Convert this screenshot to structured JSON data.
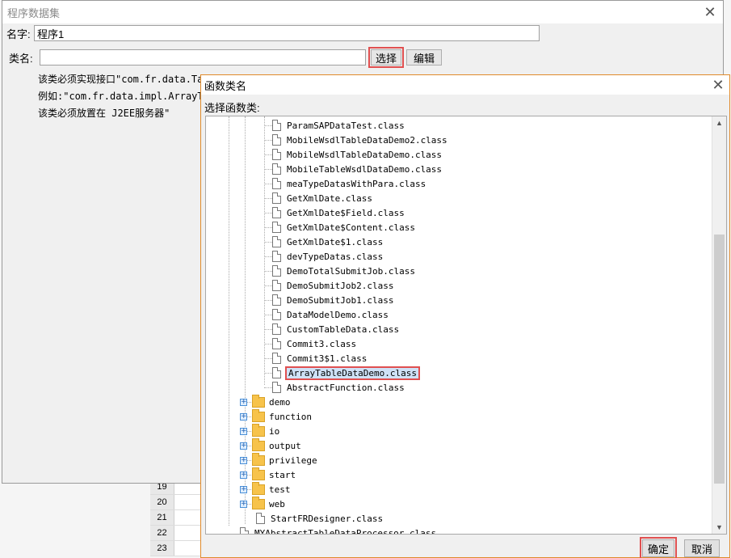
{
  "dataset_dialog": {
    "title": "程序数据集",
    "name_label": "名字:",
    "name_value": "程序1",
    "class_label": "类名:",
    "class_value": "",
    "select_button": "选择",
    "edit_button": "编辑",
    "hints": [
      "该类必须实现接口\"com.fr.data.TableData\"",
      "例如:\"com.fr.data.impl.ArrayTableData\"",
      "该类必须放置在 J2EE服务器\""
    ]
  },
  "background": {
    "row_numbers": [
      "19",
      "20",
      "21",
      "22",
      "23"
    ]
  },
  "function_dialog": {
    "title": "函数类名",
    "subtitle": "选择函数类:",
    "class_files": [
      "ParamSAPDataTest.class",
      "MobileWsdlTableDataDemo2.class",
      "MobileWsdlTableDataDemo.class",
      "MobileTableWsdlDataDemo.class",
      "meaTypeDatasWithPara.class",
      "GetXmlDate.class",
      "GetXmlDate$Field.class",
      "GetXmlDate$Content.class",
      "GetXmlDate$1.class",
      "devTypeDatas.class",
      "DemoTotalSubmitJob.class",
      "DemoSubmitJob2.class",
      "DemoSubmitJob1.class",
      "DataModelDemo.class",
      "CustomTableData.class",
      "Commit3.class",
      "Commit3$1.class",
      "ArrayTableDataDemo.class",
      "AbstractFunction.class"
    ],
    "selected_file": "ArrayTableDataDemo.class",
    "folders": [
      "demo",
      "function",
      "io",
      "output",
      "privilege",
      "start",
      "test",
      "web"
    ],
    "root_file": "StartFRDesigner.class",
    "bottom_file": "MYAbstractTableDataProcessor.class",
    "ok_button": "确定",
    "cancel_button": "取消"
  }
}
